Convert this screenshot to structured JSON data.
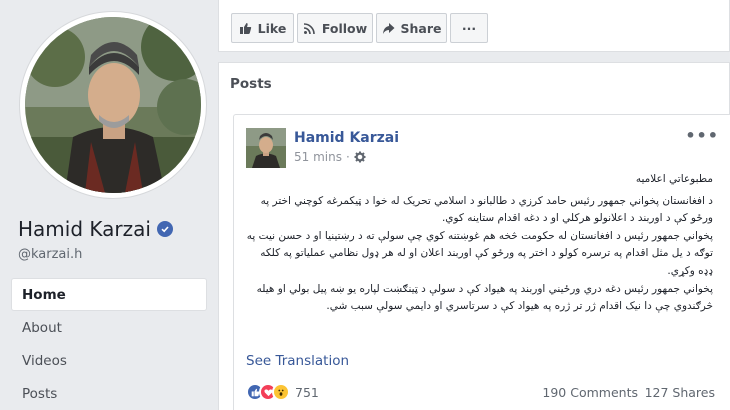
{
  "profile": {
    "name": "Hamid Karzai",
    "handle": "@karzai.h"
  },
  "nav": [
    {
      "label": "Home",
      "active": true
    },
    {
      "label": "About",
      "active": false
    },
    {
      "label": "Videos",
      "active": false
    },
    {
      "label": "Posts",
      "active": false
    }
  ],
  "actions": {
    "like": "Like",
    "follow": "Follow",
    "share": "Share",
    "more": "···"
  },
  "posts": {
    "title": "Posts",
    "post": {
      "author": "Hamid Karzai",
      "time": "51 mins",
      "more": "•••",
      "heading": "مطبوعاتي اعلاميه",
      "paragraphs": [
        "د افغانستان پخواني جمهور رئیس حامد کرزي د طالبانو د اسلامي تحریک له خوا د ټیکمرغه کوچني اختر په ورځو کې د اوربند د اعلانولو هرکلي او د دغه اقدام ستاینه کوي.",
        "پخواني جمهور رئیس د افغانستان له حکومت څخه هم غوښتنه کوي چې سولې ته د رښتینيا او د حسن نیت په توګه د یل مثل اقدام په ترسره کولو د اختر په ورځو کې اوربند اعلان او له هر ډول نظامي عملیاتو په کلکه ډډه وکړي.",
        "پخواني جمهور رئیس دغه دري ورځیني اوربند په هیواد کې د سولې د ټینګښت لپاره یو ښه پیل بولي او هیله څرګندوي چې دا نیک اقدام ژر تر ژره په هیواد کې د سرتاسري او دایمي سولې سبب شي."
      ],
      "see_translation": "See Translation",
      "reaction_count": "751",
      "comments": "190 Comments",
      "shares": "127 Shares"
    }
  },
  "colors": {
    "brand_blue": "#4267b2",
    "link_blue": "#385898",
    "page_bg": "#e9ebee"
  }
}
